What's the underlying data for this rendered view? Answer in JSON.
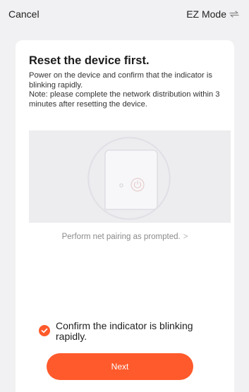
{
  "topbar": {
    "cancel_label": "Cancel",
    "mode_label": "EZ Mode",
    "mode_icon": "swap-icon"
  },
  "instructions": {
    "title": "Reset the device first.",
    "line1": "Power on the device and confirm that the indicator is blinking rapidly.",
    "line2": "Note: please complete the network distribution within 3 minutes after resetting the device."
  },
  "illustration": {
    "icon": "power-icon"
  },
  "hint": {
    "label": "Perform net pairing as prompted.",
    "chevron": ">"
  },
  "confirm": {
    "label": "Confirm the indicator is blinking rapidly.",
    "checked": true
  },
  "next_button": {
    "label": "Next"
  },
  "colors": {
    "accent": "#ff5a2b",
    "background": "#f1f1f3",
    "card": "#ffffff"
  }
}
